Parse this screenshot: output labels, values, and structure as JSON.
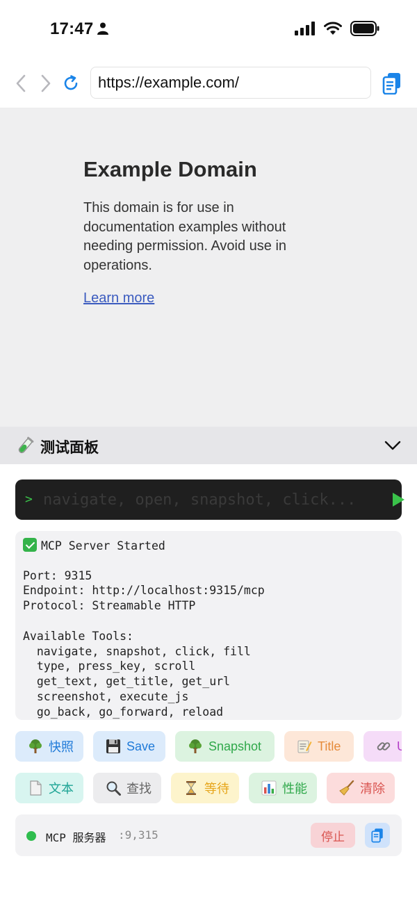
{
  "status_bar": {
    "time": "17:47"
  },
  "browser": {
    "url": "https://example.com/"
  },
  "web_page": {
    "title": "Example Domain",
    "paragraph": "This domain is for use in documentation examples without needing permission. Avoid use in operations.",
    "link_text": "Learn more"
  },
  "panel": {
    "title": "测试面板"
  },
  "command": {
    "prompt": ">",
    "placeholder": "navigate, open, snapshot, click..."
  },
  "log_lines": [
    "MCP Server Started",
    "",
    "Port: 9315",
    "Endpoint: http://localhost:9315/mcp",
    "Protocol: Streamable HTTP",
    "",
    "Available Tools:",
    "  navigate, snapshot, click, fill",
    "  type, press_key, scroll",
    "  get_text, get_title, get_url",
    "  screenshot, execute_js",
    "  go_back, go_forward, reload"
  ],
  "tools_row1": [
    {
      "label": "快照",
      "icon": "tree-icon",
      "bg": "#dcebfb",
      "color": "#1f7ad8"
    },
    {
      "label": "Save",
      "icon": "floppy-icon",
      "bg": "#dcebfb",
      "color": "#1f7ad8"
    },
    {
      "label": "Snapshot",
      "icon": "tree-icon",
      "bg": "#dcf3e0",
      "color": "#2fa84a"
    },
    {
      "label": "Title",
      "icon": "memo-icon",
      "bg": "#fde7d8",
      "color": "#e58a3a"
    },
    {
      "label": "U",
      "icon": "link-icon",
      "bg": "#f5dcf8",
      "color": "#b43fc8"
    }
  ],
  "tools_row2": [
    {
      "label": "文本",
      "icon": "document-icon",
      "bg": "#d8f5f0",
      "color": "#1fa596"
    },
    {
      "label": "查找",
      "icon": "magnifier-icon",
      "bg": "#ececee",
      "color": "#666666"
    },
    {
      "label": "等待",
      "icon": "hourglass-icon",
      "bg": "#fdf4cc",
      "color": "#e6a51a"
    },
    {
      "label": "性能",
      "icon": "bar-chart-icon",
      "bg": "#dcf3e0",
      "color": "#2fa84a"
    },
    {
      "label": "清除",
      "icon": "broom-icon",
      "bg": "#fcdcdc",
      "color": "#d9534f"
    }
  ],
  "server": {
    "label": "MCP 服务器",
    "port": ":9,315",
    "stop_label": "停止",
    "status_color": "#2fbd4e"
  }
}
